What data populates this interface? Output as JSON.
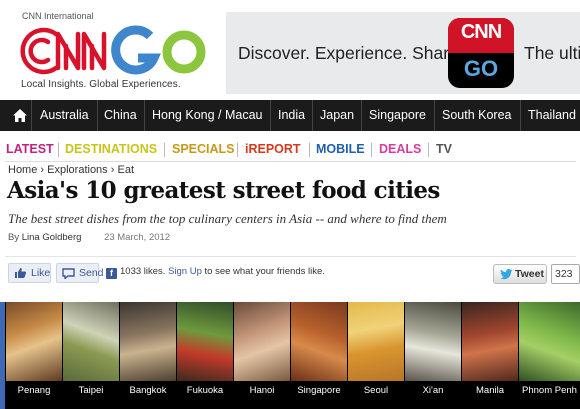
{
  "header": {
    "brand_small": "CNN International",
    "logo_text": "CNN GO",
    "tagline": "Local Insights. Global Experiences."
  },
  "banner": {
    "text1": "Discover. Experience. Share.",
    "icon_label_top": "CNN",
    "icon_label_bottom": "GO",
    "text2": "The ultim"
  },
  "nav": {
    "items": [
      "Australia",
      "China",
      "Hong Kong / Macau",
      "India",
      "Japan",
      "Singapore",
      "South Korea",
      "Thailand"
    ]
  },
  "channels": [
    {
      "label": "LATEST",
      "color": "#c0237d"
    },
    {
      "label": "DESTINATIONS",
      "color": "#c9c31a"
    },
    {
      "label": "SPECIALS",
      "color": "#c79a16"
    },
    {
      "label": "iREPORT",
      "color": "#d43a1e"
    },
    {
      "label": "MOBILE",
      "color": "#1f5fae"
    },
    {
      "label": "DEALS",
      "color": "#d83ba0"
    },
    {
      "label": "TV",
      "color": "#555555"
    }
  ],
  "breadcrumb": {
    "items": [
      "Home",
      "Explorations",
      "Eat"
    ],
    "separator": "›"
  },
  "article": {
    "headline": "Asia's 10 greatest street food cities",
    "subhead": "The best street dishes from the top culinary centers in Asia -- and where to find them",
    "byline_prefix": "By",
    "author": "Lina Goldberg",
    "date": "23 March, 2012"
  },
  "social": {
    "like_label": "Like",
    "send_label": "Send",
    "like_count_text": "1033 likes.",
    "signup_link": "Sign Up",
    "signup_suffix": "to see what your friends like.",
    "tweet_label": "Tweet",
    "tweet_count": "323"
  },
  "strip": {
    "cities": [
      "Penang",
      "Taipei",
      "Bangkok",
      "Fukuoka",
      "Hanoi",
      "Singapore",
      "Seoul",
      "Xi'an",
      "Manila",
      "Phnom Penh"
    ]
  }
}
